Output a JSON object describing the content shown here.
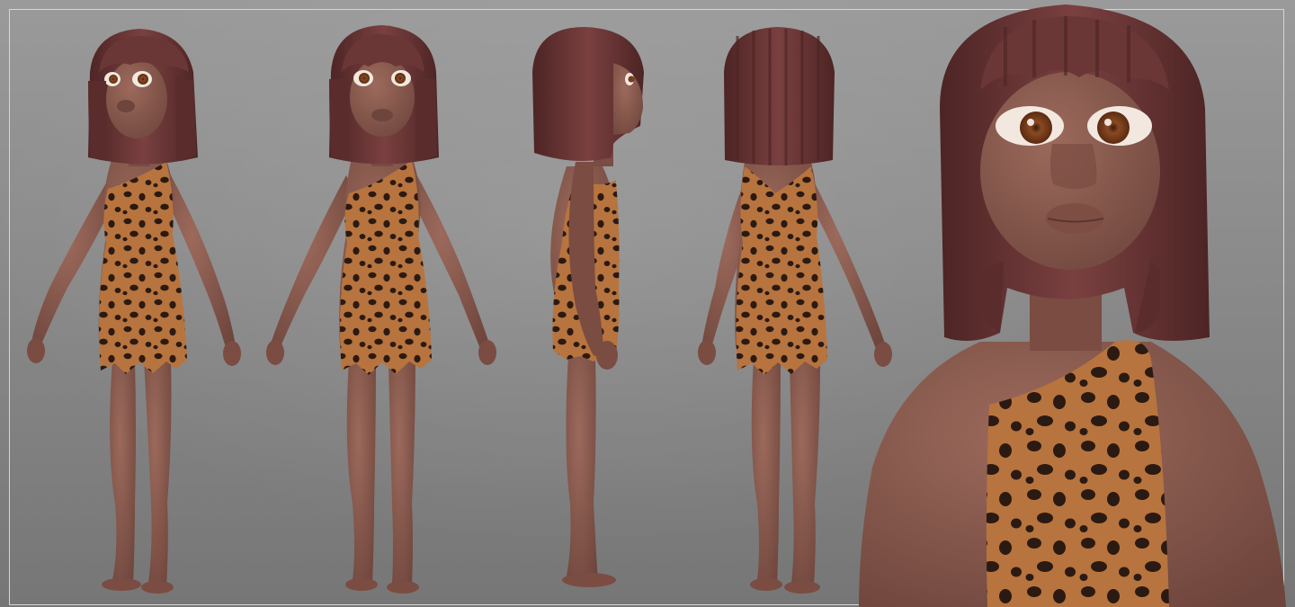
{
  "scene": {
    "description_label": "",
    "views": [
      {
        "name": "front-three-quarter"
      },
      {
        "name": "front"
      },
      {
        "name": "side"
      },
      {
        "name": "back"
      },
      {
        "name": "closeup"
      }
    ],
    "colors": {
      "skin": "#8a5a4f",
      "skin_shadow": "#6e453c",
      "hair": "#6b3636",
      "hair_dark": "#4d2424",
      "dress_base": "#b8743e",
      "spot": "#2b1a12",
      "iris": "#8a4a22",
      "frame": "#d6d6d6"
    }
  }
}
